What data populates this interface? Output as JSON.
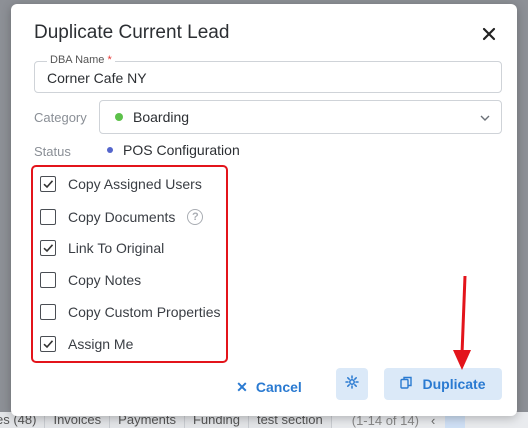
{
  "dialog": {
    "title": "Duplicate Current Lead",
    "close_icon": "close-icon"
  },
  "fields": {
    "dba_label": "DBA Name",
    "dba_required": "*",
    "dba_value": "Corner Cafe NY",
    "category_label": "Category",
    "category_value": "Boarding",
    "category_dot_color": "#5cc14a",
    "status_label": "Status",
    "status_value": "POS Configuration",
    "status_dot_color": "#5566cc"
  },
  "options": [
    {
      "label": "Copy Assigned Users",
      "checked": true
    },
    {
      "label": "Copy Documents",
      "checked": false,
      "help": "?"
    },
    {
      "label": "Link To Original",
      "checked": true
    },
    {
      "label": "Copy Notes",
      "checked": false
    },
    {
      "label": "Copy Custom Properties",
      "checked": false
    },
    {
      "label": "Assign Me",
      "checked": true
    }
  ],
  "footer": {
    "cancel_label": "Cancel",
    "cancel_icon": "x-icon",
    "settings_icon": "gear-icon",
    "duplicate_label": "Duplicate",
    "duplicate_icon": "copy-icon"
  },
  "background_tabs": {
    "tabs": [
      "es (48)",
      "Invoices",
      "Payments",
      "Funding",
      "test section"
    ],
    "count": "(1-14 of 14)",
    "chevron": "‹"
  },
  "colors": {
    "accent": "#2a7ad1",
    "highlight": "#e3141b"
  }
}
